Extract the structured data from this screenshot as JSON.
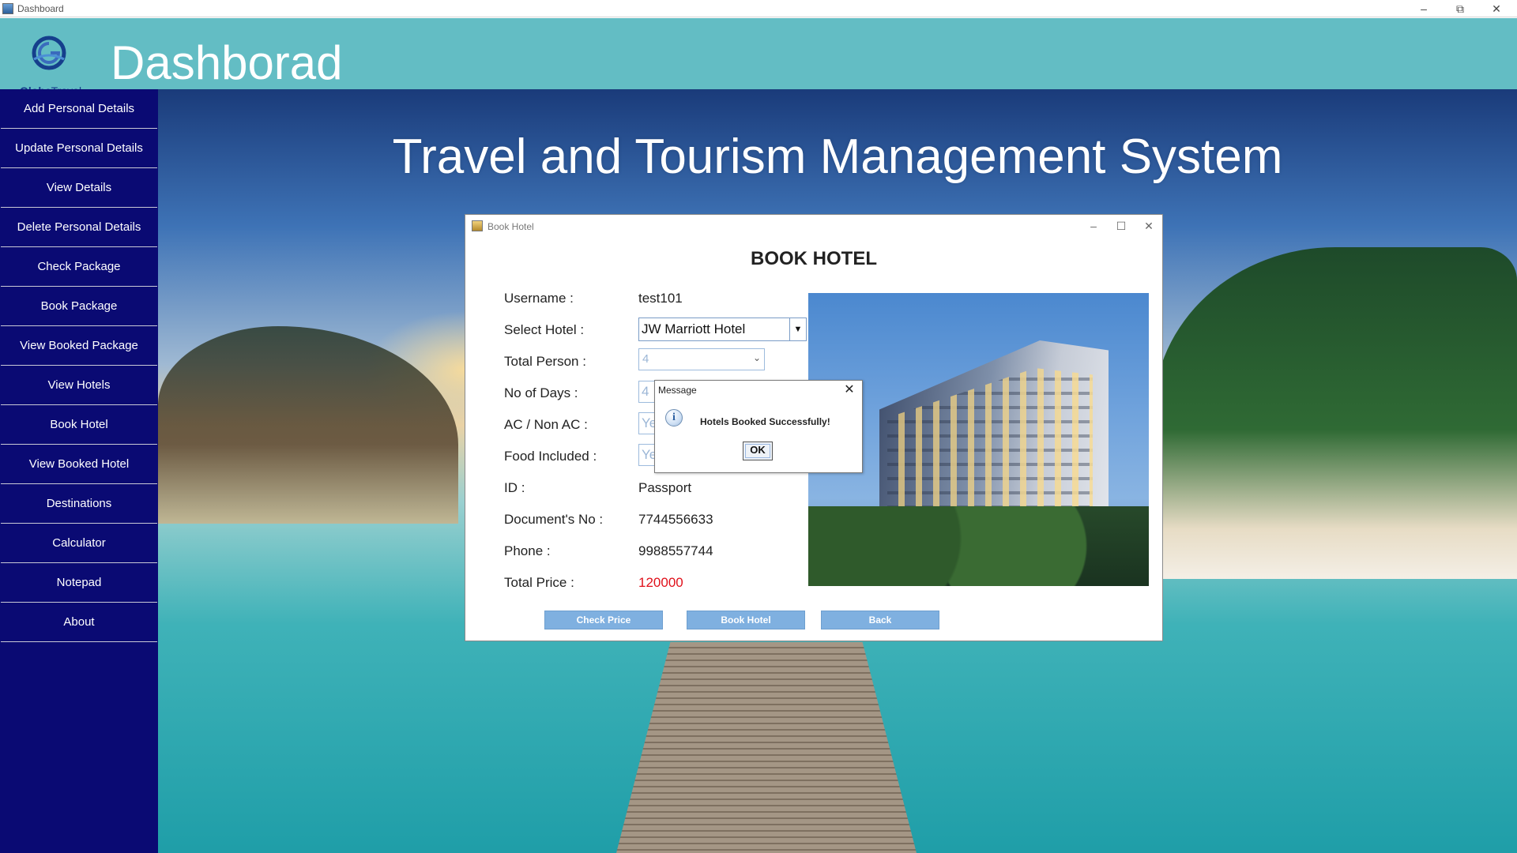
{
  "window": {
    "title": "Dashboard"
  },
  "header": {
    "title": "Dashborad",
    "logo_text_1": "Globe",
    "logo_text_2": "Travel"
  },
  "sidebar": {
    "items": [
      {
        "label": "Add Personal Details"
      },
      {
        "label": "Update Personal Details"
      },
      {
        "label": "View Details"
      },
      {
        "label": "Delete Personal Details"
      },
      {
        "label": "Check Package"
      },
      {
        "label": "Book Package"
      },
      {
        "label": "View Booked Package"
      },
      {
        "label": "View Hotels"
      },
      {
        "label": "Book Hotel"
      },
      {
        "label": "View Booked Hotel"
      },
      {
        "label": "Destinations"
      },
      {
        "label": "Calculator"
      },
      {
        "label": "Notepad"
      },
      {
        "label": "About"
      }
    ]
  },
  "main": {
    "hero_title": "Travel and Tourism Management System"
  },
  "book_hotel": {
    "window_title": "Book Hotel",
    "heading": "BOOK HOTEL",
    "labels": {
      "username": "Username  :",
      "select_hotel": "Select Hotel  :",
      "total_person": "Total Person  :",
      "no_of_days": "No of Days  :",
      "ac": "AC / Non AC  :",
      "food": "Food Included  :",
      "id": "ID  :",
      "doc_no": "Document's No  :",
      "phone": "Phone  :",
      "total_price": "Total Price  :"
    },
    "values": {
      "username": "test101",
      "hotel": "JW Marriott Hotel",
      "total_person": "4",
      "no_of_days": "4",
      "ac": "Ye",
      "food": "Ye",
      "id": "Passport",
      "doc_no": "7744556633",
      "phone": "9988557744",
      "total_price": "120000"
    },
    "buttons": {
      "check_price": "Check Price",
      "book_hotel": "Book Hotel",
      "back": "Back"
    }
  },
  "message_dialog": {
    "title": "Message",
    "text": "Hotels Booked Successfully!",
    "ok": "OK",
    "icon_glyph": "i"
  },
  "colors": {
    "header_bg": "#63bdc4",
    "sidebar_bg": "#0a0a73",
    "button_bg": "#7fb0e0",
    "price_color": "#e0101a"
  }
}
